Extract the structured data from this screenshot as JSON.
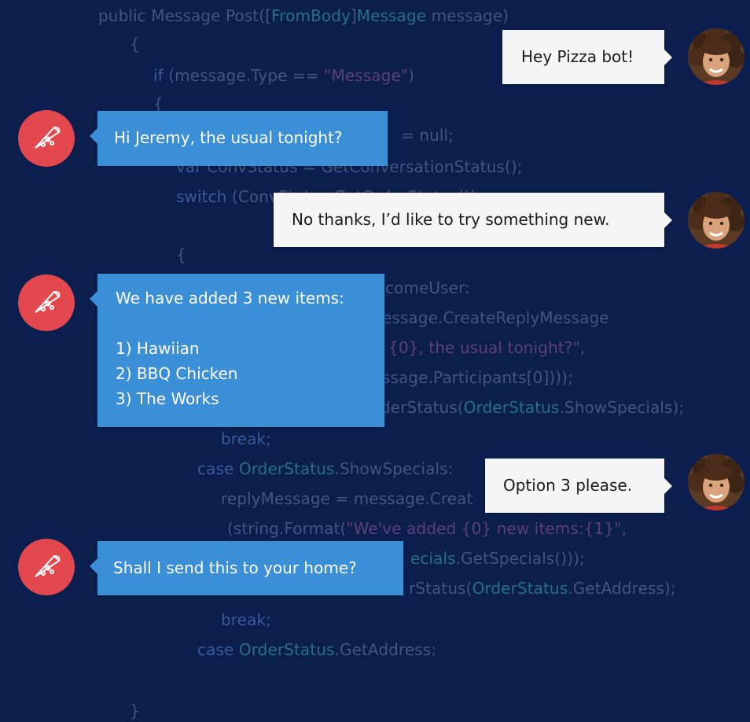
{
  "code_lines": [
    {
      "segments": [
        {
          "t": "public Message Post([",
          "c": "fa"
        },
        {
          "t": "FromBody",
          "c": "ty"
        },
        {
          "t": "]",
          "c": "fa"
        },
        {
          "t": "Message",
          "c": "ty"
        },
        {
          "t": " message)",
          "c": "fa"
        }
      ]
    },
    {
      "segments": [
        {
          "t": "{",
          "c": "fa"
        }
      ]
    },
    {
      "segments": [
        {
          "t": "if",
          "c": "kw"
        },
        {
          "t": " (message.Type == ",
          "c": "fa"
        },
        {
          "t": "\"Message\"",
          "c": "st"
        },
        {
          "t": ")",
          "c": "fa"
        }
      ]
    },
    {
      "segments": [
        {
          "t": "{",
          "c": "fa"
        }
      ]
    },
    {
      "segments": [
        {
          "t": "= null;",
          "c": "fa"
        }
      ]
    },
    {
      "segments": [
        {
          "t": "var",
          "c": "kw"
        },
        {
          "t": " ConvStatus = GetConversationStatus();",
          "c": "fa"
        }
      ]
    },
    {
      "segments": [
        {
          "t": "switch",
          "c": "kw"
        },
        {
          "t": " (ConvStatus.GetOrderStatus())",
          "c": "fa"
        }
      ]
    },
    {
      "segments": [
        {
          "t": "{",
          "c": "fa"
        }
      ]
    },
    {
      "segments": [
        {
          "t": "comeUser:",
          "c": "fa"
        }
      ]
    },
    {
      "segments": [
        {
          "t": "essage.CreateReplyMessage",
          "c": "fa"
        }
      ]
    },
    {
      "segments": [
        {
          "t": "{0}, the usual tonight?\",",
          "c": "st"
        }
      ]
    },
    {
      "segments": [
        {
          "t": "ssage.Participants[0])));",
          "c": "fa"
        }
      ]
    },
    {
      "segments": [
        {
          "t": "derStatus(",
          "c": "fa"
        },
        {
          "t": "OrderStatus",
          "c": "ty"
        },
        {
          "t": ".ShowSpecials);",
          "c": "fa"
        }
      ]
    },
    {
      "segments": [
        {
          "t": "break;",
          "c": "kw"
        }
      ]
    },
    {
      "segments": [
        {
          "t": "case",
          "c": "kw"
        },
        {
          "t": " ",
          "c": "fa"
        },
        {
          "t": "OrderStatus",
          "c": "ty"
        },
        {
          "t": ".ShowSpecials:",
          "c": "fa"
        }
      ]
    },
    {
      "segments": [
        {
          "t": "replyMessage = message.Creat",
          "c": "fa"
        }
      ]
    },
    {
      "segments": [
        {
          "t": "(string.Format(",
          "c": "fa"
        },
        {
          "t": "\"We've added {0} new items:{1}\",",
          "c": "st"
        }
      ]
    },
    {
      "segments": [
        {
          "t": "ecials",
          "c": "ty"
        },
        {
          "t": ".GetSpecials()));",
          "c": "fa"
        }
      ]
    },
    {
      "segments": [
        {
          "t": "rStatus(",
          "c": "fa"
        },
        {
          "t": "OrderStatus",
          "c": "ty"
        },
        {
          "t": ".GetAddress);",
          "c": "fa"
        }
      ]
    },
    {
      "segments": [
        {
          "t": "break;",
          "c": "kw"
        }
      ]
    },
    {
      "segments": [
        {
          "t": "case",
          "c": "kw"
        },
        {
          "t": " ",
          "c": "fa"
        },
        {
          "t": "OrderStatus",
          "c": "ty"
        },
        {
          "t": ".GetAddress:",
          "c": "fa"
        }
      ]
    },
    {
      "segments": [
        {
          "t": "}",
          "c": "fa"
        }
      ]
    }
  ],
  "messages": [
    {
      "from": "user",
      "lines": [
        "Hey Pizza bot!"
      ]
    },
    {
      "from": "bot",
      "lines": [
        "Hi Jeremy, the usual tonight?"
      ]
    },
    {
      "from": "user",
      "lines": [
        "No thanks, I’d like to try something new."
      ]
    },
    {
      "from": "bot",
      "lines": [
        "We have added 3 new items:",
        "",
        "1) Hawiian",
        "2) BBQ Chicken",
        "3) The Works"
      ]
    },
    {
      "from": "user",
      "lines": [
        "Option 3 please."
      ]
    },
    {
      "from": "bot",
      "lines": [
        "Shall I send this to your home?"
      ]
    }
  ],
  "icons": {
    "bot": "pizza-slice-icon",
    "user": "user-avatar"
  },
  "colors": {
    "background": "#0b1e4e",
    "bot_bubble": "#3b8fd6",
    "user_bubble": "#f5f5f5",
    "bot_avatar": "#e4484f"
  }
}
